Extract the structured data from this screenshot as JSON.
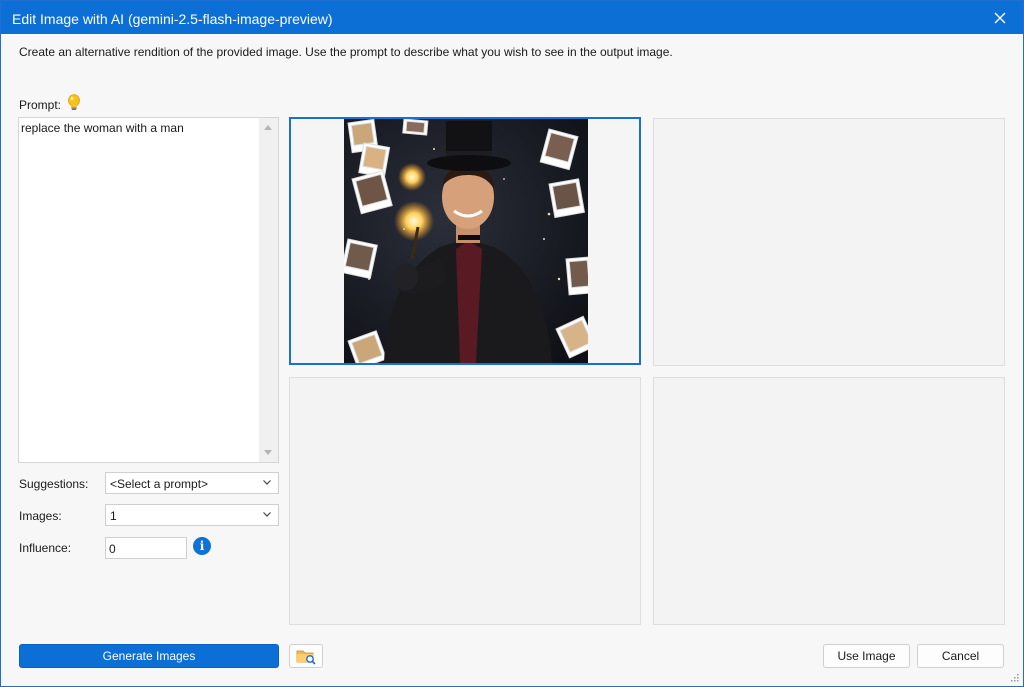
{
  "window": {
    "title": "Edit Image with AI (gemini-2.5-flash-image-preview)",
    "accent": "#0b6fd6"
  },
  "description": "Create an alternative rendition of the provided image. Use the prompt to describe what you wish to see in the output image.",
  "prompt": {
    "label": "Prompt:",
    "value": "replace the woman with a man"
  },
  "suggestions": {
    "label": "Suggestions:",
    "value": "<Select a prompt>"
  },
  "images": {
    "label": "Images:",
    "value": "1"
  },
  "influence": {
    "label": "Influence:",
    "value": "0"
  },
  "buttons": {
    "generate": "Generate Images",
    "use_image": "Use Image",
    "cancel": "Cancel"
  },
  "gallery": {
    "selected_index": 0,
    "tiles": [
      {
        "name": "generated-image-1",
        "has_image": true
      },
      {
        "name": "generated-image-2",
        "has_image": false
      },
      {
        "name": "generated-image-3",
        "has_image": false
      },
      {
        "name": "generated-image-4",
        "has_image": false
      }
    ]
  }
}
